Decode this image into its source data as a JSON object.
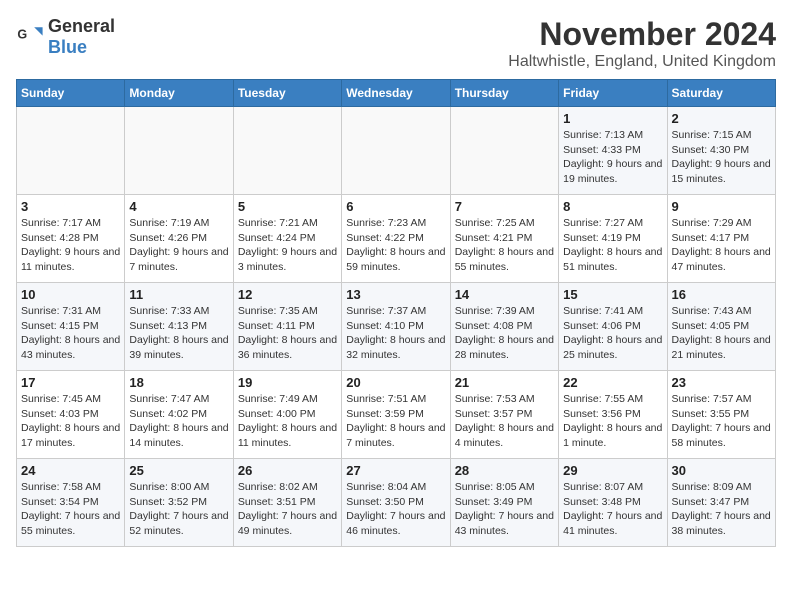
{
  "header": {
    "logo_general": "General",
    "logo_blue": "Blue",
    "month_title": "November 2024",
    "location": "Haltwhistle, England, United Kingdom"
  },
  "days_of_week": [
    "Sunday",
    "Monday",
    "Tuesday",
    "Wednesday",
    "Thursday",
    "Friday",
    "Saturday"
  ],
  "weeks": [
    [
      {
        "day": "",
        "info": ""
      },
      {
        "day": "",
        "info": ""
      },
      {
        "day": "",
        "info": ""
      },
      {
        "day": "",
        "info": ""
      },
      {
        "day": "",
        "info": ""
      },
      {
        "day": "1",
        "info": "Sunrise: 7:13 AM\nSunset: 4:33 PM\nDaylight: 9 hours and 19 minutes."
      },
      {
        "day": "2",
        "info": "Sunrise: 7:15 AM\nSunset: 4:30 PM\nDaylight: 9 hours and 15 minutes."
      }
    ],
    [
      {
        "day": "3",
        "info": "Sunrise: 7:17 AM\nSunset: 4:28 PM\nDaylight: 9 hours and 11 minutes."
      },
      {
        "day": "4",
        "info": "Sunrise: 7:19 AM\nSunset: 4:26 PM\nDaylight: 9 hours and 7 minutes."
      },
      {
        "day": "5",
        "info": "Sunrise: 7:21 AM\nSunset: 4:24 PM\nDaylight: 9 hours and 3 minutes."
      },
      {
        "day": "6",
        "info": "Sunrise: 7:23 AM\nSunset: 4:22 PM\nDaylight: 8 hours and 59 minutes."
      },
      {
        "day": "7",
        "info": "Sunrise: 7:25 AM\nSunset: 4:21 PM\nDaylight: 8 hours and 55 minutes."
      },
      {
        "day": "8",
        "info": "Sunrise: 7:27 AM\nSunset: 4:19 PM\nDaylight: 8 hours and 51 minutes."
      },
      {
        "day": "9",
        "info": "Sunrise: 7:29 AM\nSunset: 4:17 PM\nDaylight: 8 hours and 47 minutes."
      }
    ],
    [
      {
        "day": "10",
        "info": "Sunrise: 7:31 AM\nSunset: 4:15 PM\nDaylight: 8 hours and 43 minutes."
      },
      {
        "day": "11",
        "info": "Sunrise: 7:33 AM\nSunset: 4:13 PM\nDaylight: 8 hours and 39 minutes."
      },
      {
        "day": "12",
        "info": "Sunrise: 7:35 AM\nSunset: 4:11 PM\nDaylight: 8 hours and 36 minutes."
      },
      {
        "day": "13",
        "info": "Sunrise: 7:37 AM\nSunset: 4:10 PM\nDaylight: 8 hours and 32 minutes."
      },
      {
        "day": "14",
        "info": "Sunrise: 7:39 AM\nSunset: 4:08 PM\nDaylight: 8 hours and 28 minutes."
      },
      {
        "day": "15",
        "info": "Sunrise: 7:41 AM\nSunset: 4:06 PM\nDaylight: 8 hours and 25 minutes."
      },
      {
        "day": "16",
        "info": "Sunrise: 7:43 AM\nSunset: 4:05 PM\nDaylight: 8 hours and 21 minutes."
      }
    ],
    [
      {
        "day": "17",
        "info": "Sunrise: 7:45 AM\nSunset: 4:03 PM\nDaylight: 8 hours and 17 minutes."
      },
      {
        "day": "18",
        "info": "Sunrise: 7:47 AM\nSunset: 4:02 PM\nDaylight: 8 hours and 14 minutes."
      },
      {
        "day": "19",
        "info": "Sunrise: 7:49 AM\nSunset: 4:00 PM\nDaylight: 8 hours and 11 minutes."
      },
      {
        "day": "20",
        "info": "Sunrise: 7:51 AM\nSunset: 3:59 PM\nDaylight: 8 hours and 7 minutes."
      },
      {
        "day": "21",
        "info": "Sunrise: 7:53 AM\nSunset: 3:57 PM\nDaylight: 8 hours and 4 minutes."
      },
      {
        "day": "22",
        "info": "Sunrise: 7:55 AM\nSunset: 3:56 PM\nDaylight: 8 hours and 1 minute."
      },
      {
        "day": "23",
        "info": "Sunrise: 7:57 AM\nSunset: 3:55 PM\nDaylight: 7 hours and 58 minutes."
      }
    ],
    [
      {
        "day": "24",
        "info": "Sunrise: 7:58 AM\nSunset: 3:54 PM\nDaylight: 7 hours and 55 minutes."
      },
      {
        "day": "25",
        "info": "Sunrise: 8:00 AM\nSunset: 3:52 PM\nDaylight: 7 hours and 52 minutes."
      },
      {
        "day": "26",
        "info": "Sunrise: 8:02 AM\nSunset: 3:51 PM\nDaylight: 7 hours and 49 minutes."
      },
      {
        "day": "27",
        "info": "Sunrise: 8:04 AM\nSunset: 3:50 PM\nDaylight: 7 hours and 46 minutes."
      },
      {
        "day": "28",
        "info": "Sunrise: 8:05 AM\nSunset: 3:49 PM\nDaylight: 7 hours and 43 minutes."
      },
      {
        "day": "29",
        "info": "Sunrise: 8:07 AM\nSunset: 3:48 PM\nDaylight: 7 hours and 41 minutes."
      },
      {
        "day": "30",
        "info": "Sunrise: 8:09 AM\nSunset: 3:47 PM\nDaylight: 7 hours and 38 minutes."
      }
    ]
  ]
}
